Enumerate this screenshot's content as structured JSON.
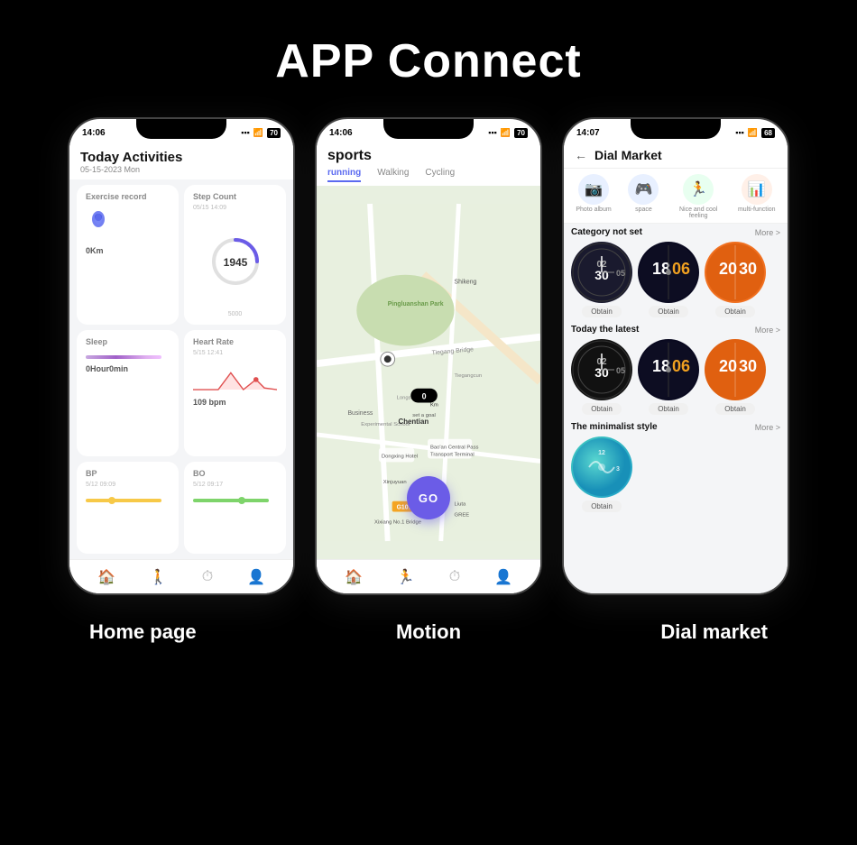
{
  "page": {
    "title": "APP Connect",
    "background": "#000000"
  },
  "phone1": {
    "status_time": "14:06",
    "status_right": "70",
    "header_title": "Today Activities",
    "header_date": "05-15-2023 Mon",
    "exercise_label": "Exercise record",
    "exercise_sublabel": "",
    "exercise_km": "0Km",
    "step_label": "Step Count",
    "step_sublabel": "05/15 14:09",
    "step_value": "1945",
    "step_goal": "5000",
    "sleep_label": "Sleep",
    "sleep_value": "0Hour0min",
    "heart_label": "Heart Rate",
    "heart_sublabel": "5/15 12:41",
    "heart_value": "109 bpm",
    "bp_label": "BP",
    "bp_sublabel": "5/12 09:09",
    "bo_label": "BO",
    "bo_sublabel": "5/12 09:17",
    "bottom_label": "Home page"
  },
  "phone2": {
    "status_time": "14:06",
    "status_right": "70",
    "header_title": "sports",
    "tabs": [
      "running",
      "Walking",
      "Cycling"
    ],
    "active_tab": "running",
    "go_button": "GO",
    "bottom_label": "Motion"
  },
  "phone3": {
    "status_time": "14:07",
    "status_right": "68",
    "header_title": "Dial Market",
    "cat_icons": [
      {
        "label": "Photo album",
        "icon": "📷"
      },
      {
        "label": "space",
        "icon": "🎮"
      },
      {
        "label": "Nice and cool feeling",
        "icon": "🏃"
      },
      {
        "label": "multi-function",
        "icon": "📊"
      }
    ],
    "sections": [
      {
        "title": "Category not set",
        "more": "More >",
        "items": [
          {
            "style": "dark-analog",
            "obtain": "Obtain"
          },
          {
            "style": "neon-digital",
            "obtain": "Obtain"
          },
          {
            "style": "orange-digital",
            "obtain": "Obtain"
          }
        ]
      },
      {
        "title": "Today the latest",
        "more": "More >",
        "items": [
          {
            "style": "dark-analog2",
            "obtain": "Obtain"
          },
          {
            "style": "neon-digital2",
            "obtain": "Obtain"
          },
          {
            "style": "orange-digital2",
            "obtain": "Obtain"
          }
        ]
      },
      {
        "title": "The minimalist style",
        "more": "More >",
        "items": [
          {
            "style": "teal-minimal",
            "obtain": "Obtain"
          }
        ]
      }
    ],
    "bottom_label": "Dial market"
  }
}
